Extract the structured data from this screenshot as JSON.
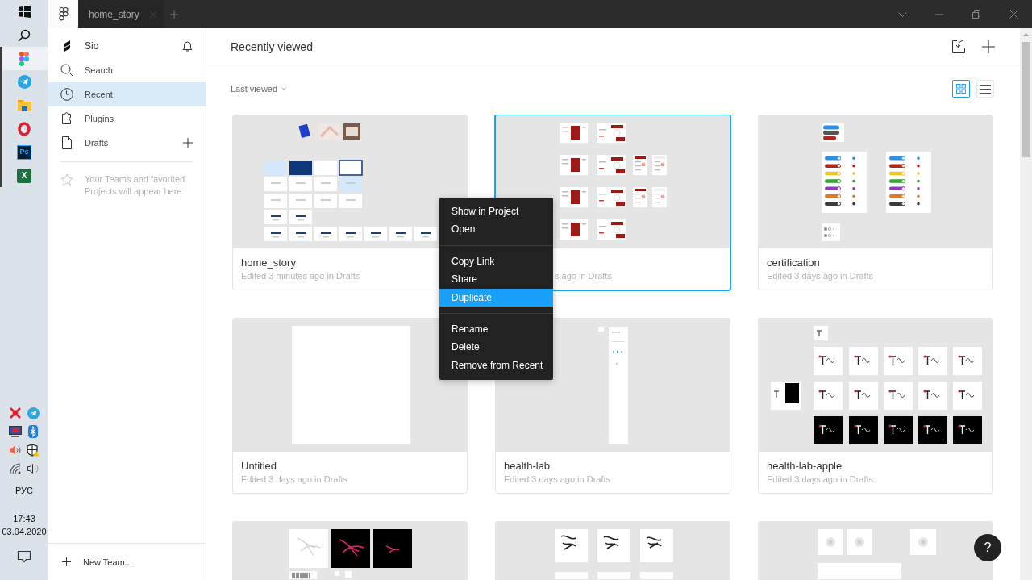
{
  "taskbar": {
    "apps": [
      {
        "kind": "start",
        "running": false,
        "selected": false
      },
      {
        "kind": "search",
        "running": false,
        "selected": false
      },
      {
        "kind": "shapes",
        "running": true,
        "selected": true
      },
      {
        "kind": "plane",
        "running": true,
        "selected": false
      },
      {
        "kind": "folder",
        "running": true,
        "selected": false
      },
      {
        "kind": "ring",
        "running": true,
        "selected": false
      },
      {
        "kind": "tile",
        "label": "Ps",
        "running": true,
        "selected": false
      },
      {
        "kind": "sheet",
        "label": "X",
        "running": true,
        "selected": false
      }
    ],
    "tray": [
      {
        "kind": "burst"
      },
      {
        "kind": "plane"
      },
      {
        "kind": "monitor"
      },
      {
        "kind": "bluetooth"
      },
      {
        "kind": "speaker"
      },
      {
        "kind": "shield"
      },
      {
        "kind": "wifi"
      },
      {
        "kind": "volume"
      }
    ],
    "language": "РУС",
    "time": "17:43",
    "date": "03.04.2020"
  },
  "titlebar": {
    "tabs": [
      {
        "label": "home_story",
        "selected": true
      }
    ]
  },
  "sidebar": {
    "items": [
      {
        "kind": "team",
        "label": "Sio",
        "selected": false
      },
      {
        "kind": "search",
        "label": "Search",
        "selected": false
      },
      {
        "kind": "recent",
        "label": "Recent",
        "selected": true
      },
      {
        "kind": "plugins",
        "label": "Plugins",
        "selected": false
      },
      {
        "kind": "drafts",
        "label": "Drafts",
        "selected": false
      }
    ],
    "hint": "Your Teams and favorited Projects will appear here",
    "footer": "New Team..."
  },
  "main": {
    "title": "Recently viewed",
    "sort": "Last viewed",
    "view_toggles": [
      {
        "kind": "grid",
        "selected": true
      },
      {
        "kind": "list",
        "selected": false
      }
    ]
  },
  "cards": [
    {
      "kind": "tiles",
      "title": "home_story",
      "meta": "Edited 3 minutes ago in Drafts",
      "selected": false,
      "covered": false
    },
    {
      "kind": "pages",
      "meta": "s ago in Drafts",
      "selected": true,
      "covered": true
    },
    {
      "kind": "badges",
      "title": "certification",
      "meta": "Edited 3 days ago in Drafts",
      "selected": false,
      "covered": false
    },
    {
      "kind": "blank",
      "title": "Untitled",
      "meta": "Edited 3 days ago in Drafts",
      "selected": false,
      "covered": false
    },
    {
      "kind": "column",
      "title": "health-lab",
      "meta": "Edited 3 days ago in Drafts",
      "selected": false,
      "covered": false
    },
    {
      "kind": "logos",
      "title": "health-lab-apple",
      "meta": "Edited 3 days ago in Drafts",
      "selected": false,
      "covered": false
    },
    {
      "kind": "artwork",
      "selected": false
    },
    {
      "kind": "sketches",
      "selected": false
    },
    {
      "kind": "icons",
      "selected": false
    }
  ],
  "context_menu": {
    "groups": [
      {
        "items": [
          {
            "label": "Show in Project",
            "selected": false
          },
          {
            "label": "Open",
            "selected": false
          }
        ]
      },
      {
        "items": [
          {
            "label": "Copy Link",
            "selected": false
          },
          {
            "label": "Share",
            "selected": false
          },
          {
            "label": "Duplicate",
            "selected": true
          }
        ]
      },
      {
        "items": [
          {
            "label": "Rename",
            "selected": false
          },
          {
            "label": "Delete",
            "selected": false
          },
          {
            "label": "Remove from Recent",
            "selected": false
          }
        ]
      }
    ]
  },
  "help": {
    "label": "?"
  }
}
